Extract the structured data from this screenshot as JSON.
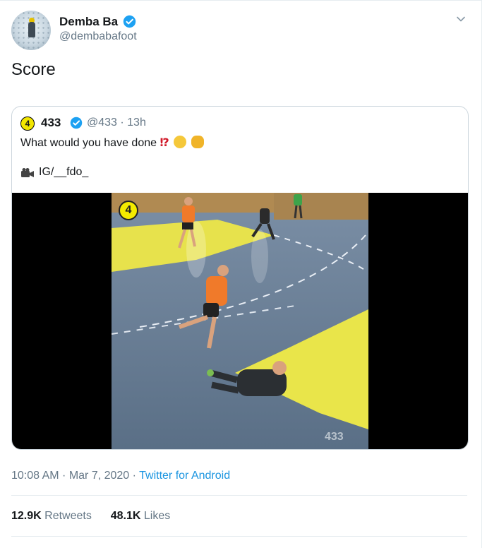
{
  "author": {
    "name": "Demba Ba",
    "handle": "@dembabafoot"
  },
  "tweet": {
    "text": "Score"
  },
  "quoted": {
    "avatar_label": "4",
    "name": "433",
    "handle_time": "@433 · 13h",
    "text": "What would you have done",
    "exclaim": "⁉",
    "credit": "IG/__fdo_",
    "video_logo": "4",
    "watermark": "433"
  },
  "meta": {
    "time_date": "10:08 AM · Mar 7, 2020 · ",
    "source": "Twitter for Android"
  },
  "stats": {
    "retweets_count": "12.9K",
    "retweets_label": " Retweets",
    "likes_count": "48.1K",
    "likes_label": " Likes"
  },
  "colors": {
    "link": "#1b95e0",
    "verified": "#1da1f2",
    "secondary_text": "#657786"
  },
  "icons": [
    "verified-icon",
    "chevron-down-icon",
    "camera-icon",
    "thinking-face-emoji",
    "clapping-hands-emoji"
  ]
}
